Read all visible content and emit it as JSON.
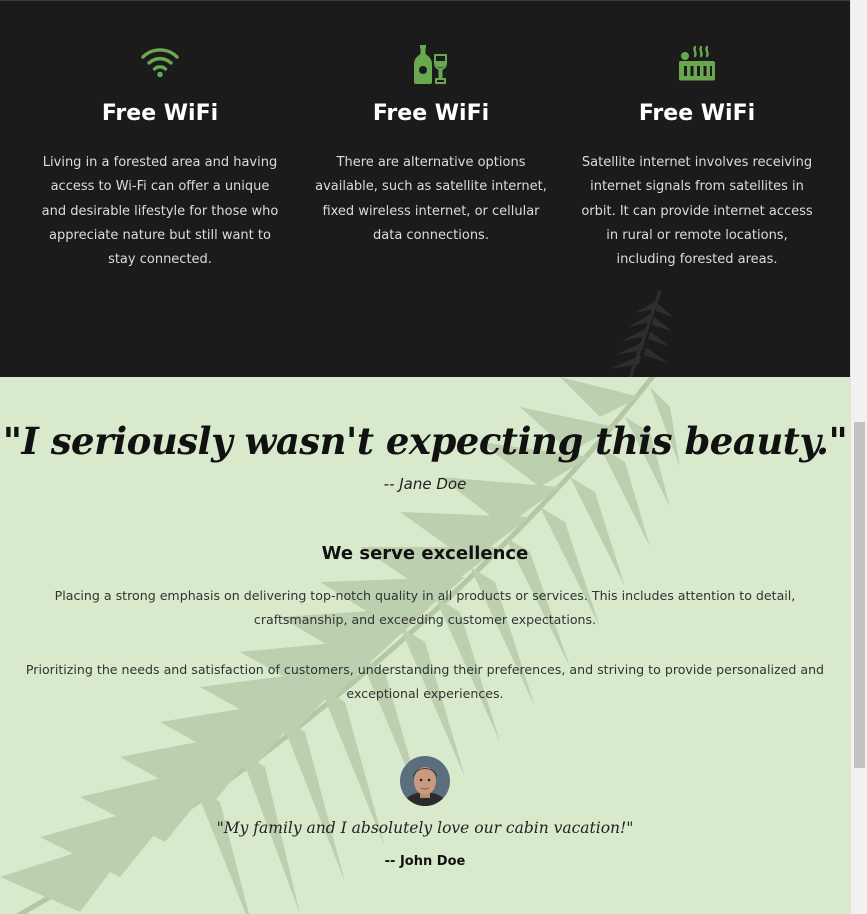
{
  "features": [
    {
      "icon": "wifi-icon",
      "title": "Free WiFi",
      "text": "Living in a forested area and having access to Wi-Fi can offer a unique and desirable lifestyle for those who appreciate nature but still want to stay connected."
    },
    {
      "icon": "wine-bottle-icon",
      "title": "Free WiFi",
      "text": "There are alternative options available, such as satellite internet, fixed wireless internet, or cellular data connections."
    },
    {
      "icon": "hot-tub-icon",
      "title": "Free WiFi",
      "text": "Satellite internet involves receiving internet signals from satellites in orbit. It can provide internet access in rural or remote locations, including forested areas."
    }
  ],
  "quote": {
    "text": "\"I seriously wasn't expecting this beauty.\"",
    "author": "-- Jane Doe"
  },
  "serve": {
    "title": "We serve excellence",
    "paragraph1": "Placing a strong emphasis on delivering top-notch quality in all products or services. This includes attention to detail, craftsmanship, and exceeding customer expectations.",
    "paragraph2": "Prioritizing the needs and satisfaction of customers, understanding their preferences, and striving to provide personalized and exceptional experiences."
  },
  "testimonial": {
    "text": "\"My family and I absolutely love our cabin vacation!\"",
    "author": "-- John Doe"
  },
  "colors": {
    "dark_bg": "#1b1b1b",
    "accent_green": "#6aa84f",
    "light_bg": "#d9e9cb",
    "fern": "#b8cda8"
  }
}
